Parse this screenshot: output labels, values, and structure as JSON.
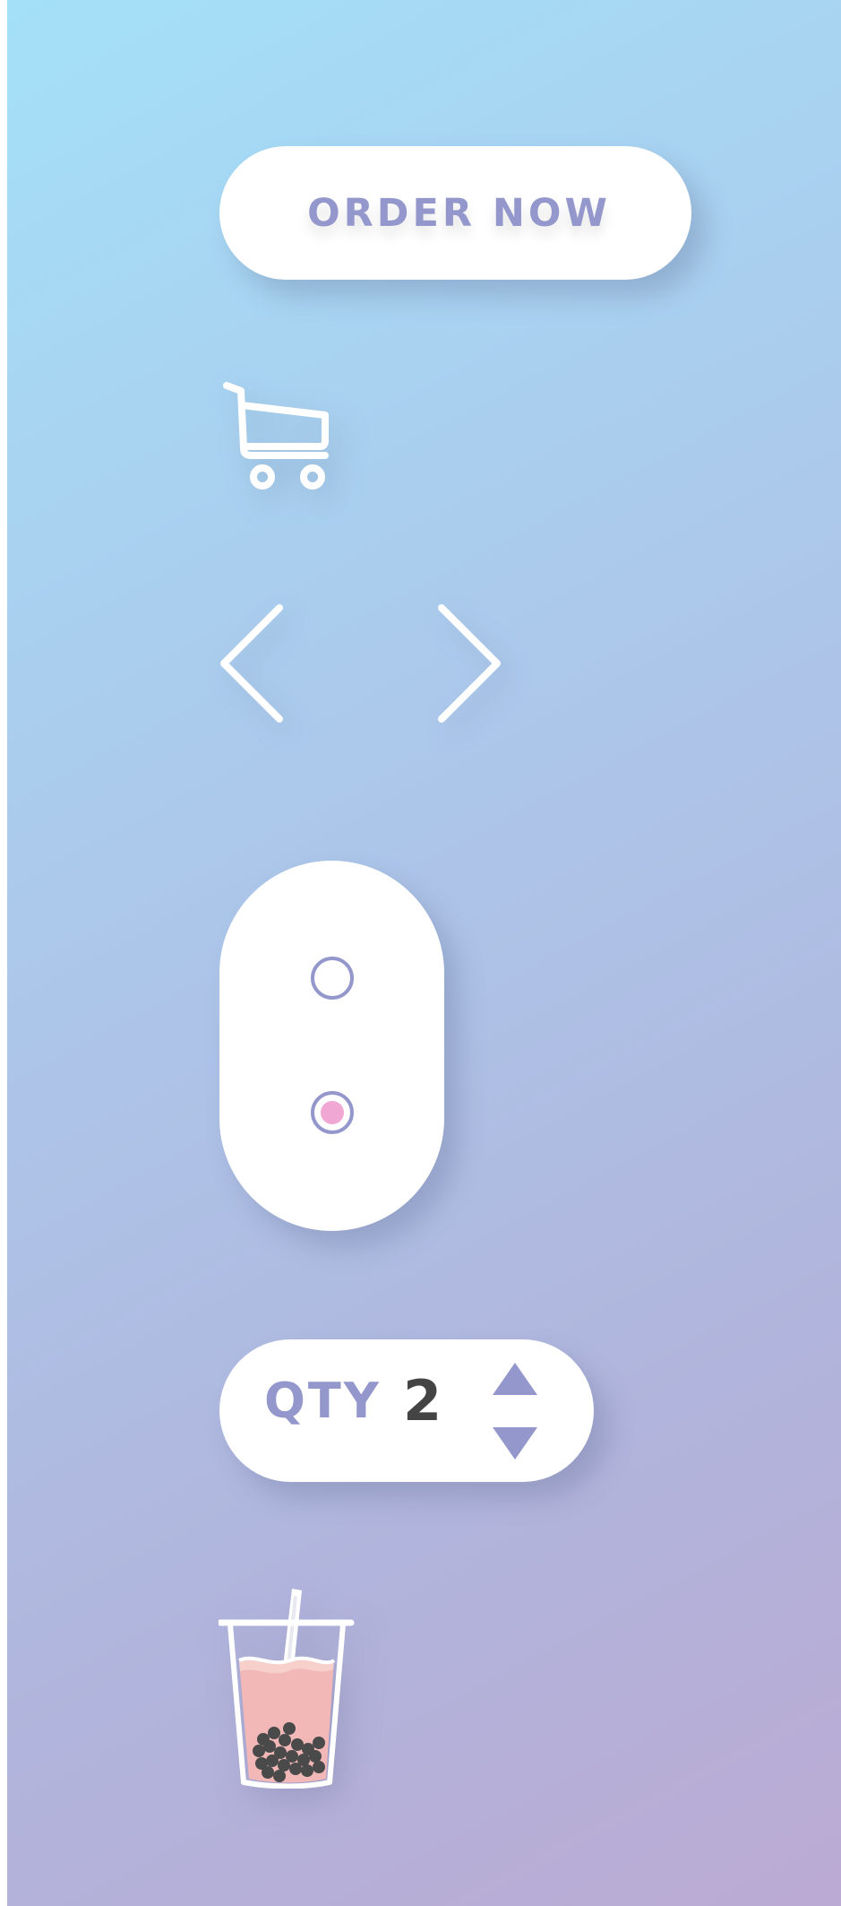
{
  "colors": {
    "background_start": "#a4e0f8",
    "background_end": "#bbaad3",
    "accent": "#9397cb",
    "pill_fill": "#ffffff",
    "selected_dot": "#f0a7d3",
    "quantity_text": "#444444",
    "tea": "#f2b8b8",
    "pearls": "#4a4a4a"
  },
  "order_button": {
    "label": "ORDER NOW"
  },
  "icons": {
    "cart": "cart-icon",
    "previous": "chevron-left-icon",
    "next": "chevron-right-icon",
    "quantity_up": "triangle-up-icon",
    "quantity_down": "triangle-down-icon",
    "drink": "bubble-tea-icon"
  },
  "radio_group": {
    "options_count": 2,
    "selected_index": 1
  },
  "quantity": {
    "label": "QTY",
    "value": "2"
  }
}
